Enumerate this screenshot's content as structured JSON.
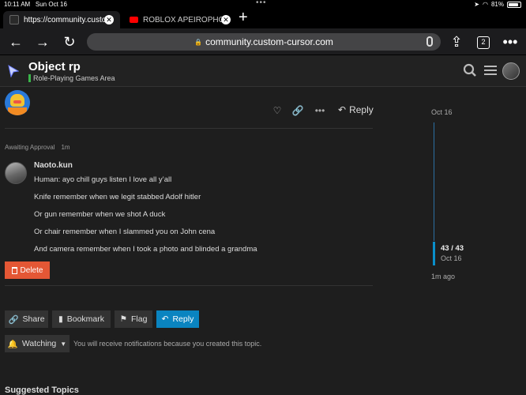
{
  "status_bar": {
    "time": "10:11 AM",
    "date": "Sun Oct 16",
    "battery": "81%"
  },
  "tabs": [
    {
      "title": "https://community.custom-cursor.com",
      "favicon_color": "#2a2a2a",
      "active": true
    },
    {
      "title": "ROBLOX APEIROPHOBIA",
      "favicon_color": "#ff0000",
      "active": false
    }
  ],
  "address_bar": {
    "url": "community.custom-cursor.com",
    "tab_count": "2"
  },
  "site_header": {
    "topic_title": "Object rp",
    "category": "Role-Playing Games Area",
    "category_color": "#3ab54a"
  },
  "top_post": {
    "reply_label": "Reply"
  },
  "pending_post": {
    "status": "Awaiting Approval",
    "age": "1m",
    "username": "Naoto.kun",
    "lines": [
      "Human: ayo chill guys listen I love all y’all",
      "Knife remember when we legit stabbed Adolf hitler",
      "Or gun remember when we shot A duck",
      "Or chair remember when I slammed you on John cena",
      "And camera remember when I took a photo and blinded a grandma"
    ],
    "delete_label": "Delete"
  },
  "timeline": {
    "start_date": "Oct 16",
    "position": "43 / 43",
    "position_date": "Oct 16",
    "last_activity": "1m ago"
  },
  "footer_buttons": {
    "share": "Share",
    "bookmark": "Bookmark",
    "flag": "Flag",
    "reply": "Reply"
  },
  "notifications": {
    "level": "Watching",
    "description": "You will receive notifications because you created this topic."
  },
  "suggested_heading": "Suggested Topics",
  "colors": {
    "accent": "#0a84c0",
    "danger": "#e45735",
    "background": "#1e1e1e"
  }
}
